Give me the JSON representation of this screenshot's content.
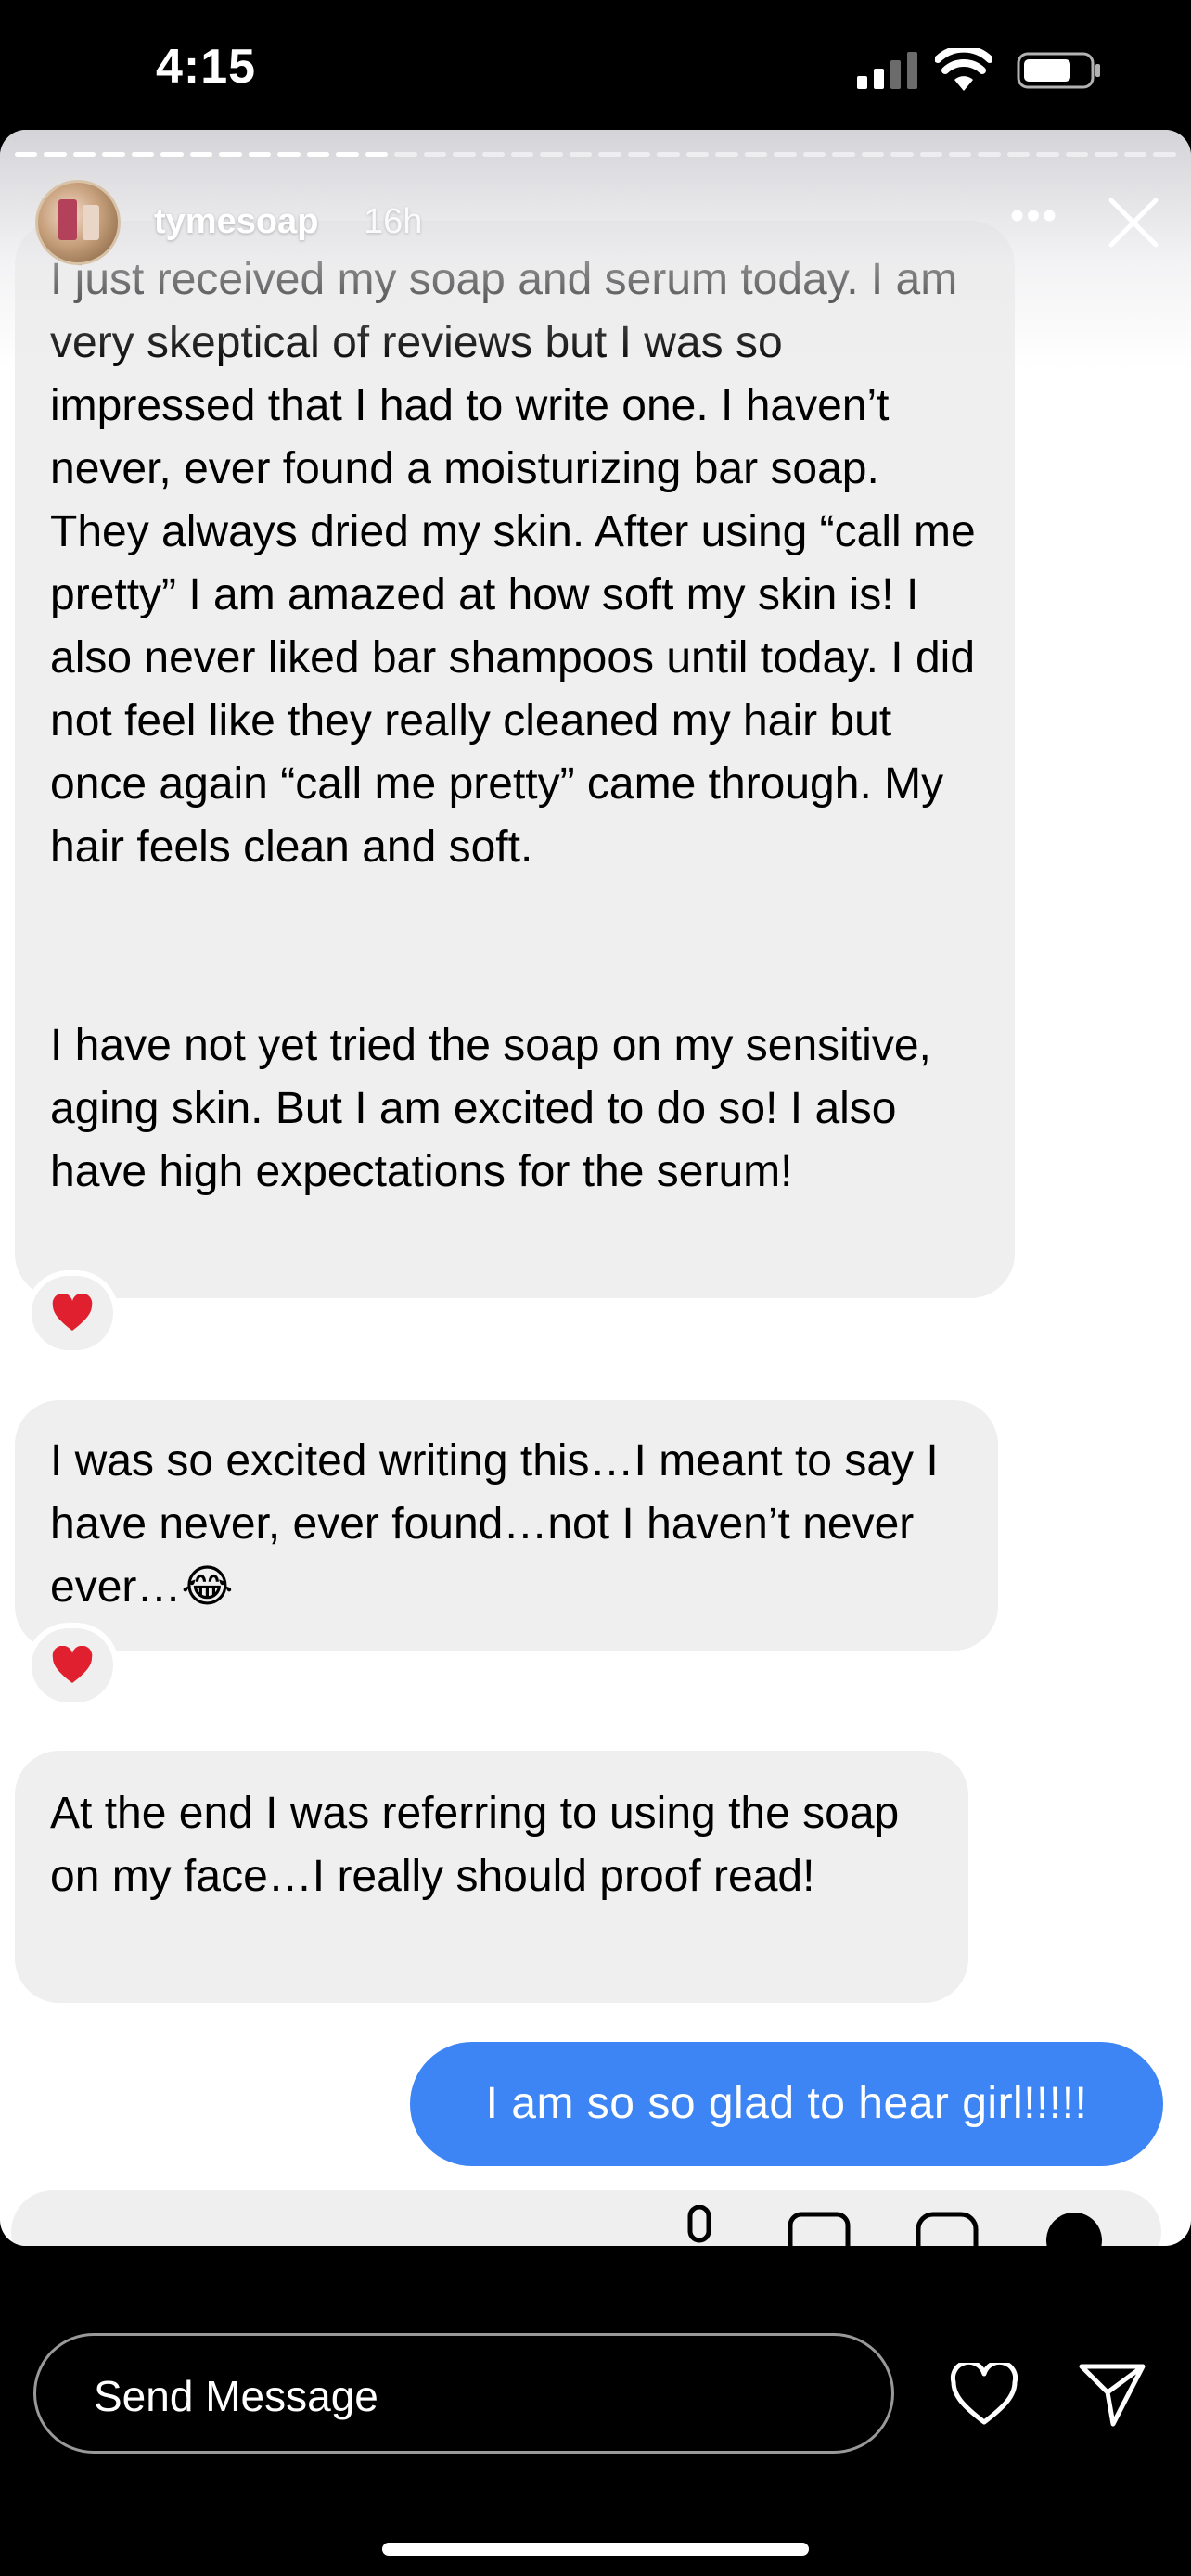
{
  "status_bar": {
    "time": "4:15",
    "icons": [
      "signal-icon",
      "wifi-icon",
      "battery-icon"
    ]
  },
  "story": {
    "progress_segments": 40,
    "progress_filled": 13,
    "username": "tymesoap",
    "time_ago": "16h"
  },
  "messages": [
    {
      "paragraphs": [
        "I just received my soap and serum today. I am very skeptical of reviews but I was so impressed that I had to write one. I haven’t never, ever found a moisturizing bar soap. They always dried my skin. After using “call me pretty” I am amazed at how soft my skin is! I also never liked bar shampoos until today. I did not feel like they really cleaned my hair but once again “call me pretty” came through. My hair feels clean and soft.",
        "I have not yet tried the soap on my sensitive, aging skin. But I am excited to do so! I also have high expectations for the serum!"
      ],
      "reaction": "❤️"
    },
    {
      "text": "I was so excited writing this…I meant to say I have never, ever found…not I haven’t never ever…😂",
      "reaction": "❤️"
    },
    {
      "text": "At the end I was referring to using the soap on my face…I really should proof read!"
    }
  ],
  "reply": {
    "text": "I am so so glad to hear girl!!!!!"
  },
  "footer": {
    "send_placeholder": "Send Message"
  },
  "colors": {
    "sent_bubble": "#3d84f5",
    "received_bubble": "#efefef",
    "heart": "#e0202e"
  }
}
